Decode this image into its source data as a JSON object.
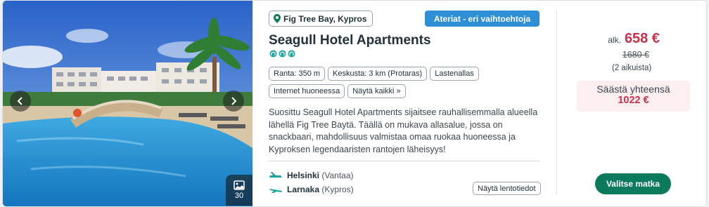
{
  "hotel": {
    "location": "Fig Tree Bay, Kypros",
    "meal_badge": "Ateriat - eri vaihtoehtoja",
    "name": "Seagull Hotel Apartments",
    "rating_icons": 3,
    "features": [
      "Ranta: 350 m",
      "Keskusta: 3 km (Protaras)",
      "Lastenallas",
      "Internet huoneessa"
    ],
    "show_all": "Näytä kaikki »",
    "description": "Suosittu Seagull Hotel Apartments sijaitsee rauhallisemmalla alueella lähellä Fig Tree Baytä. Täällä on mukava allasalue, jossa on snackbaari, mahdollisuus valmistaa omaa ruokaa huoneessa ja Kyproksen legendaaristen rantojen läheisyys!",
    "photo_count": "30"
  },
  "flights": {
    "departure_city": "Helsinki",
    "departure_sub": "(Vantaa)",
    "arrival_city": "Larnaka",
    "arrival_sub": "(Kypros)",
    "show_flights": "Näytä lentotiedot"
  },
  "pricing": {
    "prefix": "alk.",
    "price": "658 €",
    "old_price": "1680 €",
    "persons": "(2 aikuista)",
    "savings_label": "Säästä yhteensä",
    "savings_amount": "1022 €",
    "select_button": "Valitse matka"
  },
  "colors": {
    "accent_red": "#c9304b",
    "badge_blue": "#2e8fd6",
    "button_green": "#0c7a5c",
    "rating_teal": "#1aa3a0"
  }
}
